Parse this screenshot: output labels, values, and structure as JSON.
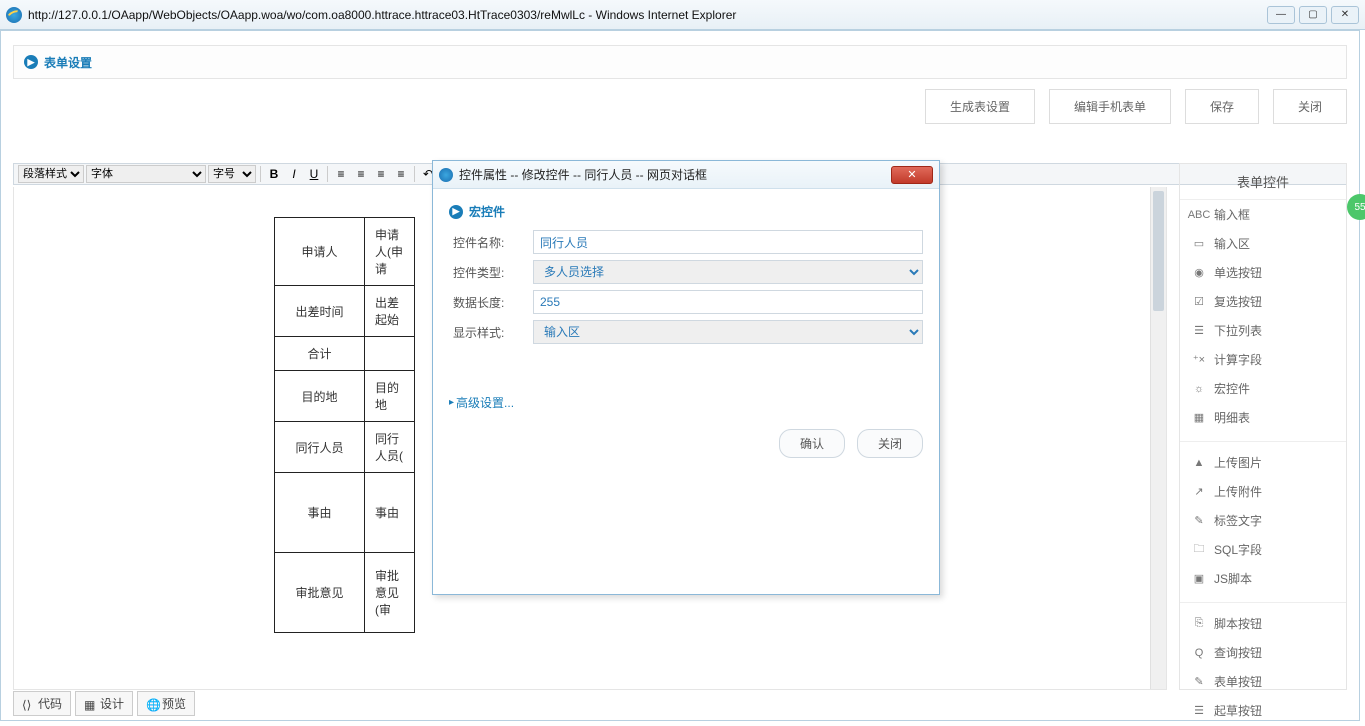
{
  "window": {
    "url": "http://127.0.0.1/OAapp/WebObjects/OAapp.woa/wo/com.oa8000.httrace.httrace03.HtTrace0303/reMwlLc - Windows Internet Explorer",
    "min": "—",
    "max": "▢",
    "close": "✕"
  },
  "green_badge": "55",
  "page": {
    "title": "表单设置"
  },
  "actions": {
    "gen": "生成表设置",
    "editMobile": "编辑手机表单",
    "save": "保存",
    "close": "关闭"
  },
  "toolbar": {
    "paraStyle": "段落样式",
    "font": "字体",
    "fontSize": "字号"
  },
  "formTable": {
    "rows": [
      {
        "label": "申请人",
        "value": "申请人(申请"
      },
      {
        "label": "出差时间",
        "value": "出差起始"
      },
      {
        "label": "合计",
        "value": ""
      },
      {
        "label": "目的地",
        "value": "目的地"
      },
      {
        "label": "同行人员",
        "value": "同行人员("
      },
      {
        "label": "事由",
        "value": "事由",
        "tall": true
      },
      {
        "label": "审批意见",
        "value": "审批意见(审",
        "tall": true
      }
    ]
  },
  "sidePanel": {
    "title": "表单控件",
    "group1": [
      {
        "icon": "ABC",
        "label": "输入框"
      },
      {
        "icon": "▭",
        "label": "输入区"
      },
      {
        "icon": "◉",
        "label": "单选按钮"
      },
      {
        "icon": "☑",
        "label": "复选按钮"
      },
      {
        "icon": "☰",
        "label": "下拉列表"
      },
      {
        "icon": "⁺×",
        "label": "计算字段"
      },
      {
        "icon": "☼",
        "label": "宏控件"
      },
      {
        "icon": "▦",
        "label": "明细表"
      }
    ],
    "group2": [
      {
        "icon": "▲",
        "label": "上传图片"
      },
      {
        "icon": "↗",
        "label": "上传附件"
      },
      {
        "icon": "✎",
        "label": "标签文字"
      },
      {
        "icon": "🗀",
        "label": "SQL字段"
      },
      {
        "icon": "▣",
        "label": "JS脚本"
      }
    ],
    "group3": [
      {
        "icon": "⎘",
        "label": "脚本按钮"
      },
      {
        "icon": "Q",
        "label": "查询按钮"
      },
      {
        "icon": "✎",
        "label": "表单按钮"
      },
      {
        "icon": "☰",
        "label": "起草按钮"
      }
    ]
  },
  "bottomTabs": {
    "code": "代码",
    "design": "设计",
    "preview": "预览"
  },
  "modal": {
    "title": "控件属性 -- 修改控件 -- 同行人员 -- 网页对话框",
    "sectionTitle": "宏控件",
    "fields": {
      "nameLabel": "控件名称:",
      "nameValue": "同行人员",
      "typeLabel": "控件类型:",
      "typeValue": "多人员选择",
      "lenLabel": "数据长度:",
      "lenValue": "255",
      "dispLabel": "显示样式:",
      "dispValue": "输入区"
    },
    "advanced": "高级设置...",
    "ok": "确认",
    "cancel": "关闭"
  }
}
